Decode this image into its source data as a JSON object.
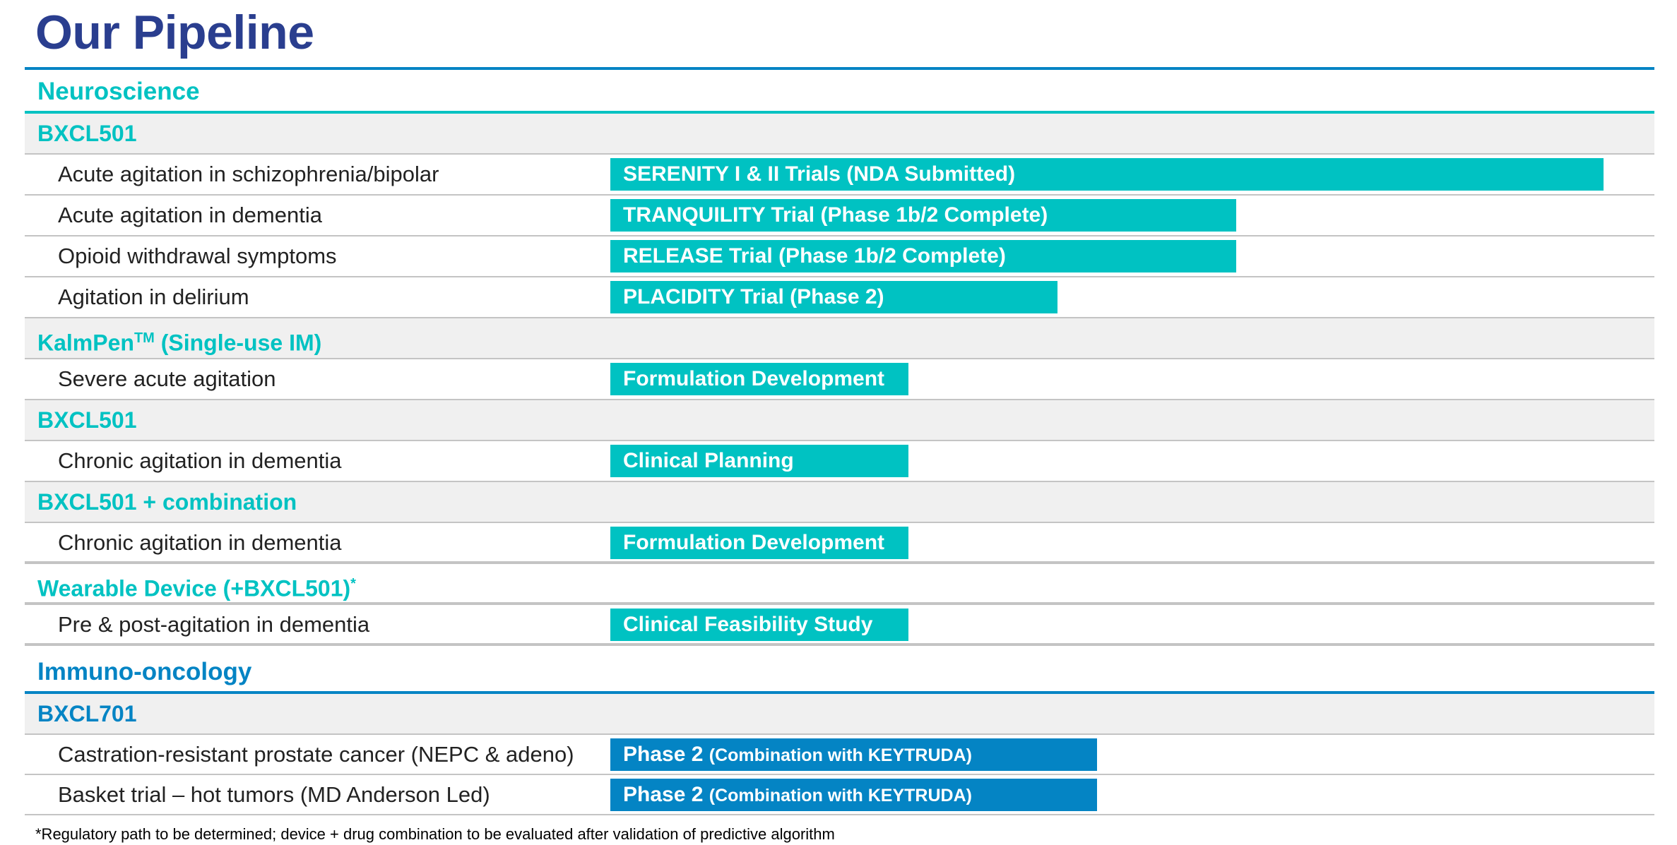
{
  "title": "Our Pipeline",
  "colors": {
    "title": "#2a3e8f",
    "teal": "#00c2c2",
    "blue": "#0484c4",
    "row_alt": "#f0f0f0",
    "divider": "#c4c4c4"
  },
  "neuroscience": {
    "heading": "Neuroscience",
    "g1": {
      "label": "BXCL501"
    },
    "r1": {
      "indication": "Acute agitation in schizophrenia/bipolar",
      "bar": "SERENITY I & II Trials (NDA Submitted)",
      "progress": 1.0
    },
    "r2": {
      "indication": "Acute agitation in dementia",
      "bar": "TRANQUILITY Trial (Phase 1b/2 Complete)",
      "progress": 0.63
    },
    "r3": {
      "indication": "Opioid withdrawal symptoms",
      "bar": "RELEASE Trial (Phase 1b/2 Complete)",
      "progress": 0.63
    },
    "r4": {
      "indication": "Agitation in delirium",
      "bar": "PLACIDITY Trial (Phase 2)",
      "progress": 0.45
    },
    "g2": {
      "label": "KalmPen",
      "sup": "TM",
      "suffix": " (Single-use IM)"
    },
    "r5": {
      "indication": "Severe acute agitation",
      "bar": "Formulation Development",
      "progress": 0.3
    },
    "g3": {
      "label": "BXCL501"
    },
    "r6": {
      "indication": "Chronic agitation in dementia",
      "bar": "Clinical Planning",
      "progress": 0.3
    },
    "g4": {
      "label": "BXCL501 + combination"
    },
    "r7": {
      "indication": "Chronic agitation in dementia",
      "bar": "Formulation Development",
      "progress": 0.3
    },
    "g5": {
      "label": "Wearable Device (+BXCL501)",
      "sup": "*"
    },
    "r8": {
      "indication": "Pre & post-agitation in dementia",
      "bar": "Clinical Feasibility Study",
      "progress": 0.3
    }
  },
  "immuno": {
    "heading": "Immuno-oncology",
    "g1": {
      "label": "BXCL701"
    },
    "r1": {
      "indication": "Castration-resistant prostate cancer (NEPC & adeno)",
      "bar_main": "Phase 2",
      "bar_note": "(Combination with KEYTRUDA)",
      "progress": 0.49
    },
    "r2": {
      "indication": "Basket trial – hot tumors (MD Anderson Led)",
      "bar_main": "Phase 2",
      "bar_note": "(Combination with KEYTRUDA)",
      "progress": 0.49
    }
  },
  "footnote": "*Regulatory path to be determined; device + drug combination to be evaluated after validation of predictive algorithm"
}
